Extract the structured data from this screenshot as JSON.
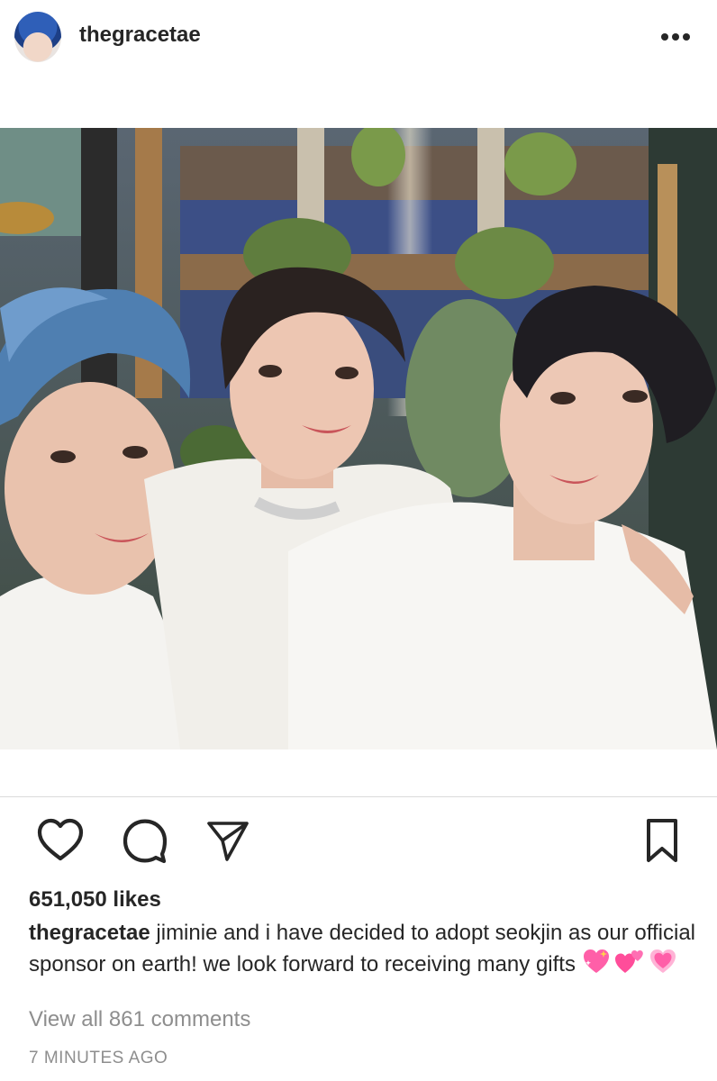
{
  "post": {
    "username": "thegracetae",
    "likes": "651,050 likes",
    "caption_user": "thegracetae",
    "caption_text": " jiminie and i have decided to adopt seokjin as our official sponsor on earth! we look forward to receiving many gifts ",
    "caption_emojis": [
      "sparkling-heart-emoji",
      "two-hearts-emoji",
      "growing-heart-emoji"
    ],
    "view_comments": "View all 861 comments",
    "time": "7 MINUTES AGO"
  },
  "icons": {
    "more": "more-options-icon",
    "like": "heart-icon",
    "comment": "comment-icon",
    "share": "paper-plane-icon",
    "save": "bookmark-icon"
  },
  "colors": {
    "text": "#262626",
    "muted": "#8e8e8e",
    "divider": "#dbdbdb",
    "emoji_pink": "#ff5fa8"
  }
}
